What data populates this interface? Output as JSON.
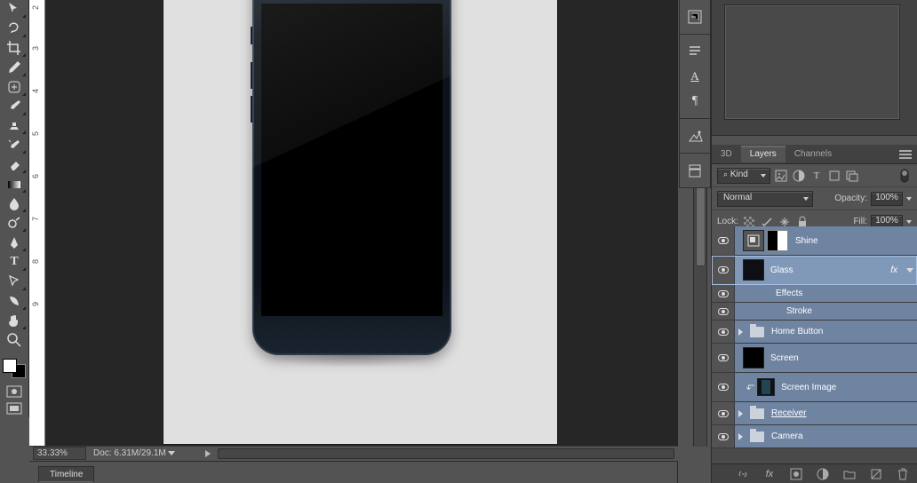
{
  "toolbar": {
    "tools": [
      {
        "name": "move-tool"
      },
      {
        "name": "lasso-tool"
      },
      {
        "name": "crop-tool"
      },
      {
        "name": "eyedropper-tool"
      },
      {
        "name": "healing-brush-tool"
      },
      {
        "name": "brush-tool"
      },
      {
        "name": "clone-stamp-tool"
      },
      {
        "name": "history-brush-tool"
      },
      {
        "name": "eraser-tool"
      },
      {
        "name": "gradient-tool"
      },
      {
        "name": "blur-tool"
      },
      {
        "name": "dodge-tool"
      },
      {
        "name": "pen-tool"
      },
      {
        "name": "type-tool",
        "letter": "T"
      },
      {
        "name": "path-select-tool"
      },
      {
        "name": "shape-tool"
      },
      {
        "name": "hand-tool"
      },
      {
        "name": "zoom-tool"
      }
    ]
  },
  "ruler": {
    "marks": [
      2,
      3,
      4,
      5,
      6,
      7,
      8,
      9
    ]
  },
  "status": {
    "zoom": "33.33%",
    "doc": "Doc: 6.31M/29.1M"
  },
  "timeline": {
    "tab": "Timeline"
  },
  "iconStack": [
    {
      "name": "history-panel"
    },
    {
      "name": "actions-panel"
    },
    {
      "name": "properties-panel"
    },
    {
      "name": "character-panel",
      "letter": "A"
    },
    {
      "name": "paragraph-panel"
    },
    {
      "name": "adjustments-panel"
    },
    {
      "name": "library-panel"
    }
  ],
  "panel": {
    "tabs": [
      "3D",
      "Layers",
      "Channels"
    ],
    "activeTab": "Layers",
    "filterKind": "Kind",
    "blendMode": "Normal",
    "opacityLabel": "Opacity:",
    "opacityValue": "100%",
    "lockLabel": "Lock:",
    "fillLabel": "Fill:",
    "fillValue": "100%"
  },
  "layers": [
    {
      "type": "vector",
      "name": "Shine",
      "masked": true
    },
    {
      "type": "vector",
      "name": "Glass",
      "masked": true,
      "fx": true,
      "selected": true,
      "effects": {
        "title": "Effects",
        "items": [
          "Stroke"
        ]
      }
    },
    {
      "type": "group",
      "name": "Home Button"
    },
    {
      "type": "vector",
      "name": "Screen",
      "thumb": "dark"
    },
    {
      "type": "smart",
      "name": "Screen Image",
      "clip": true,
      "thumb": "checker"
    },
    {
      "type": "group",
      "name": "Receiver",
      "underline": true
    },
    {
      "type": "group",
      "name": "Camera"
    }
  ]
}
